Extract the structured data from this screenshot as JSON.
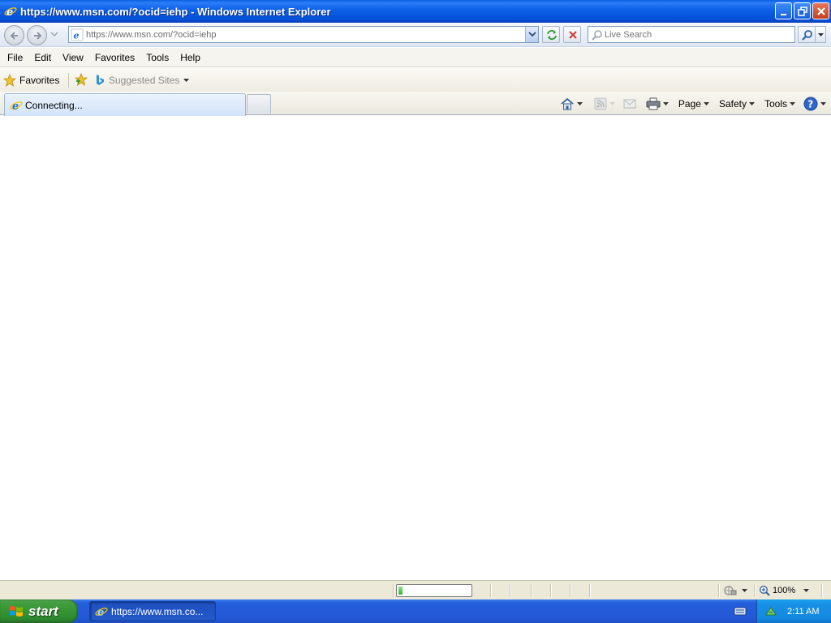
{
  "window": {
    "title": "https://www.msn.com/?ocid=iehp - Windows Internet Explorer"
  },
  "address_bar": {
    "url": "https://www.msn.com/?ocid=iehp",
    "search_placeholder": "Live Search"
  },
  "menu": {
    "items": [
      "File",
      "Edit",
      "View",
      "Favorites",
      "Tools",
      "Help"
    ]
  },
  "favorites_bar": {
    "favorites_label": "Favorites",
    "suggested_sites_label": "Suggested Sites"
  },
  "tabs": {
    "active_title": "Connecting..."
  },
  "command_bar": {
    "page_label": "Page",
    "safety_label": "Safety",
    "tools_label": "Tools"
  },
  "status_bar": {
    "progress_fraction": 0.06,
    "zoom": "100%"
  },
  "taskbar": {
    "start_label": "start",
    "task_label": "https://www.msn.co...",
    "clock": "2:11 AM"
  },
  "colors": {
    "titlebar": "#0450d8",
    "taskbar": "#245edb",
    "start_button": "#3c9a3a",
    "progress_fill": "#2eb72e"
  }
}
